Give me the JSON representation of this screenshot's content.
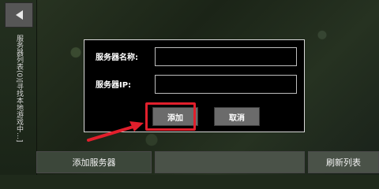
{
  "left_panel": {
    "vertical_title": "服务器列表(0)[寻找本地游戏中...]"
  },
  "dialog": {
    "name_label": "服务器名称:",
    "ip_label": "服务器IP:",
    "name_value": "",
    "ip_value": "",
    "add_label": "添加",
    "cancel_label": "取消"
  },
  "bottom_bar": {
    "add_server_label": "添加服务器",
    "middle_label": "",
    "refresh_label": "刷新列表"
  },
  "colors": {
    "highlight": "#e11f2c",
    "dialog_bg": "#000000",
    "button_gray": "#6b6b6b"
  },
  "icons": {
    "back": "back-arrow-icon",
    "pointer": "annotation-arrow-icon"
  }
}
